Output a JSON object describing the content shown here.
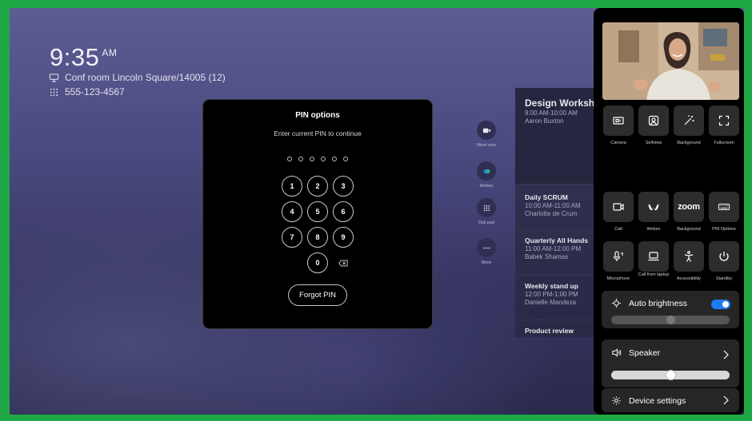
{
  "clock": {
    "time": "9:35",
    "ampm": "AM"
  },
  "room": {
    "name": "Conf room Lincoln Square/14005 (12)",
    "number": "555-123-4567"
  },
  "pin_dialog": {
    "title": "PIN options",
    "subtitle": "Enter current PIN to continue",
    "pin_length": 6,
    "keys": [
      "1",
      "2",
      "3",
      "4",
      "5",
      "6",
      "7",
      "8",
      "9",
      "0"
    ],
    "forgot_label": "Forgot PIN"
  },
  "side_buttons": [
    {
      "label": "Meet now",
      "icon": "video-plus-icon"
    },
    {
      "label": "Webex",
      "icon": "webex-icon"
    },
    {
      "label": "Dial pad",
      "icon": "dialpad-icon"
    },
    {
      "label": "More",
      "icon": "more-icon"
    }
  ],
  "meetings": [
    {
      "title": "Design Workshop",
      "time": "9:00 AM-10:00 AM",
      "person": "Aaron Buxton"
    },
    {
      "title": "Daily SCRUM",
      "time": "10:00 AM-11:00 AM",
      "person": "Charlotte de Crum"
    },
    {
      "title": "Quarterly All Hands",
      "time": "11:00 AM-12:00 PM",
      "person": "Babek Shamas"
    },
    {
      "title": "Weekly stand up",
      "time": "12:00 PM-1:00 PM",
      "person": "Danielle Mandeza"
    },
    {
      "title": "Product review",
      "time": "",
      "person": ""
    }
  ],
  "panel": {
    "tiles_row1": [
      {
        "label": "Camera",
        "icon": "camera-control-icon"
      },
      {
        "label": "Selfview",
        "icon": "selfview-icon"
      },
      {
        "label": "Background",
        "icon": "magic-wand-icon"
      },
      {
        "label": "Fullscreen",
        "icon": "fullscreen-icon"
      }
    ],
    "tiles_row2": [
      {
        "label": "Call",
        "icon": "video-call-icon"
      },
      {
        "label": "Webex",
        "icon": "webex-icon"
      },
      {
        "label": "Background",
        "icon": "zoom-icon",
        "text": "zoom"
      },
      {
        "label": "PIN Options",
        "icon": "pin-keyboard-icon"
      }
    ],
    "tiles_row3": [
      {
        "label": "Microphone",
        "icon": "microphone-icon"
      },
      {
        "label": "Call from laptop",
        "icon": "laptop-icon"
      },
      {
        "label": "Accessibility",
        "icon": "accessibility-icon"
      },
      {
        "label": "Standby",
        "icon": "power-icon"
      }
    ],
    "brightness": {
      "label": "Auto brightness",
      "enabled": true,
      "level": 0.5
    },
    "speaker": {
      "label": "Speaker",
      "volume": 0.5
    },
    "device_settings": {
      "label": "Device settings"
    }
  },
  "colors": {
    "accent": "#1d7cf2",
    "frame": "#1fa845",
    "panel": "#000000",
    "tile": "#2d2d2d"
  }
}
